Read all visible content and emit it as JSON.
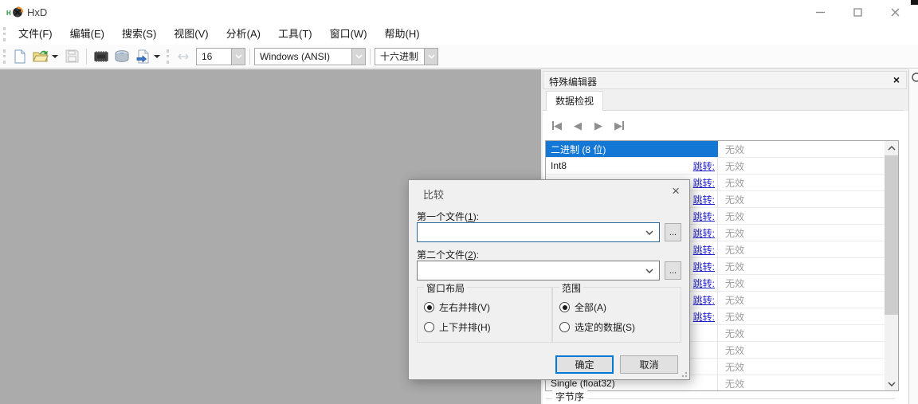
{
  "window": {
    "title": "HxD"
  },
  "menu": {
    "items": [
      {
        "name": "file",
        "label": "文件(F)"
      },
      {
        "name": "edit",
        "label": "编辑(E)"
      },
      {
        "name": "search",
        "label": "搜索(S)"
      },
      {
        "name": "view",
        "label": "视图(V)"
      },
      {
        "name": "analysis",
        "label": "分析(A)"
      },
      {
        "name": "tools",
        "label": "工具(T)"
      },
      {
        "name": "window",
        "label": "窗口(W)"
      },
      {
        "name": "help",
        "label": "帮助(H)"
      }
    ]
  },
  "toolbar": {
    "icons": [
      "new-file",
      "open-file",
      "save",
      "open-ram",
      "open-disk",
      "export",
      "row-width"
    ],
    "bytes_per_row": "16",
    "encoding": "Windows (ANSI)",
    "offset_base": "十六进制"
  },
  "panel": {
    "title": "特殊编辑器",
    "close_glyph": "×",
    "tab": "数据检视",
    "byte_order_label": "字节序",
    "rows": [
      {
        "label": "二进制  (8 位)",
        "link": "",
        "value": "无效",
        "selected": true
      },
      {
        "label": "Int8",
        "link": "跳转:",
        "value": "无效",
        "selected": false
      },
      {
        "label": "",
        "link": "跳转:",
        "value": "无效",
        "selected": false
      },
      {
        "label": "",
        "link": "跳转:",
        "value": "无效",
        "selected": false
      },
      {
        "label": "",
        "link": "跳转:",
        "value": "无效",
        "selected": false
      },
      {
        "label": "",
        "link": "跳转:",
        "value": "无效",
        "selected": false
      },
      {
        "label": "",
        "link": "跳转:",
        "value": "无效",
        "selected": false
      },
      {
        "label": "",
        "link": "跳转:",
        "value": "无效",
        "selected": false
      },
      {
        "label": "",
        "link": "跳转:",
        "value": "无效",
        "selected": false
      },
      {
        "label": "",
        "link": "跳转:",
        "value": "无效",
        "selected": false
      },
      {
        "label": "",
        "link": "跳转:",
        "value": "无效",
        "selected": false
      },
      {
        "label": "",
        "link": "",
        "value": "无效",
        "selected": false
      },
      {
        "label": "",
        "link": "",
        "value": "无效",
        "selected": false
      },
      {
        "label": "",
        "link": "",
        "value": "无效",
        "selected": false
      },
      {
        "label": "Single (float32)",
        "link": "",
        "value": "无效",
        "selected": false
      }
    ]
  },
  "dialog": {
    "title": "比较",
    "close_glyph": "×",
    "file1_label": {
      "pre": "第一个文件(",
      "key": "1",
      "post": "):"
    },
    "file2_label": {
      "pre": "第二个文件(",
      "key": "2",
      "post": "):"
    },
    "browse_label": "...",
    "layout_group": {
      "title": "窗口布局",
      "options": [
        {
          "label": "左右并排(V)",
          "selected": true
        },
        {
          "label": "上下并排(H)",
          "selected": false
        }
      ]
    },
    "range_group": {
      "title": "范围",
      "options": [
        {
          "label": "全部(A)",
          "selected": true
        },
        {
          "label": "选定的数据(S)",
          "selected": false
        }
      ]
    },
    "ok_label": "确定",
    "cancel_label": "取消"
  }
}
